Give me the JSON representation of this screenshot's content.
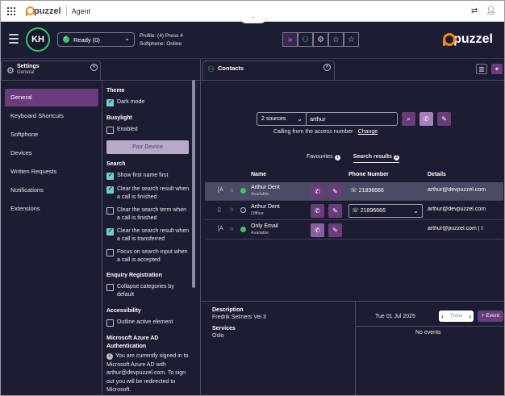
{
  "topbar": {
    "brand": "puzzel",
    "app_name": "Agent",
    "icons": [
      "apps-grid-icon",
      "transfer-icon",
      "user-icon"
    ]
  },
  "header": {
    "avatar_initials": "KH",
    "status": "Ready (0)",
    "profile": "Profile: (4) Press 4",
    "softphone": "Softphone: Online",
    "brand": "puzzel",
    "tool_icons": [
      "chevron-right-icon",
      "contacts-icon",
      "gear-icon",
      "star-outline-icon",
      "star-outline-icon"
    ]
  },
  "settings": {
    "title": "Settings",
    "subtitle": "General",
    "nav": [
      "General",
      "Keyboard Shortcuts",
      "Softphone",
      "Devices",
      "Written Requests",
      "Notifications",
      "Extensions"
    ],
    "active_nav": "General",
    "theme": {
      "heading": "Theme",
      "dark_mode": "Dark mode",
      "dark_mode_checked": true
    },
    "busylight": {
      "heading": "Busylight",
      "enabled": "Enabled",
      "enabled_checked": false,
      "pair_button": "Pair Device"
    },
    "search": {
      "heading": "Search",
      "options": [
        {
          "label": "Show first name first",
          "checked": true
        },
        {
          "label": "Clear the search result when a call is finished",
          "checked": true
        },
        {
          "label": "Clear the search term when a call is finished",
          "checked": false
        },
        {
          "label": "Clear the search result when a call is transferred",
          "checked": true
        },
        {
          "label": "Focus on search input when a call is accepted",
          "checked": false
        }
      ]
    },
    "enquiry": {
      "heading": "Enquiry Registration",
      "option": "Collapse categories by default",
      "checked": false
    },
    "accessibility": {
      "heading": "Accessibility",
      "option": "Outline active element",
      "checked": false
    },
    "azure": {
      "heading": "Microsoft Azure AD Authentication",
      "info": "You are currently signed in to Microsoft Azure AD with arthur@devpuzzel.com. To sign out you will be redirected to Microsoft."
    }
  },
  "contacts": {
    "title": "Contacts",
    "sources": "2 sources",
    "search_value": "arthur",
    "calling_text": "Calling from the access number",
    "change_link": "Change",
    "tabs": [
      {
        "label": "Favourites",
        "count": "1"
      },
      {
        "label": "Search results",
        "count": "3"
      }
    ],
    "columns": {
      "name": "Name",
      "phone": "Phone Number",
      "details": "Details"
    },
    "rows": [
      {
        "name": "Arthur Dent",
        "status": "Available",
        "phone": "21896666",
        "details": "arthur@devpuzzel.com"
      },
      {
        "name": "Arthur Dent",
        "status": "Offline",
        "phone": "21896666",
        "details": "arthur@devpuzzel.com"
      },
      {
        "name": "Only Email",
        "status": "Available",
        "phone": "",
        "details": "arthur@puzzel.com | t"
      }
    ],
    "description_label": "Description",
    "description_value": "Fredrik Selmers Vei 3",
    "services_label": "Services",
    "services_value": "Oslo",
    "calendar": {
      "date": "Tue 01 Jul 2025",
      "today": "Today",
      "event_button": "+ Event",
      "empty": "No events"
    }
  },
  "colors": {
    "background": "#1c1d33",
    "accent": "#6b3c7c",
    "status_green": "#3cc46a",
    "checkbox": "#6ecfc7",
    "brand_orange": "#f08a1c"
  }
}
